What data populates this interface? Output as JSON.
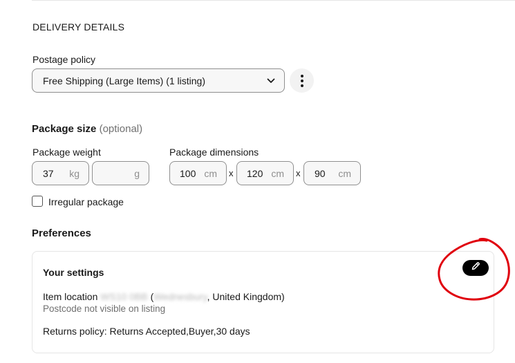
{
  "delivery": {
    "section_title": "DELIVERY DETAILS",
    "postage_label": "Postage policy",
    "postage_value": "Free Shipping (Large Items) (1 listing)"
  },
  "package": {
    "title": "Package size",
    "optional": "(optional)",
    "weight_label": "Package weight",
    "weight_kg": "37",
    "weight_kg_unit": "kg",
    "weight_g": "",
    "weight_g_unit": "g",
    "dimensions_label": "Package dimensions",
    "dim_length": "100",
    "dim_width": "120",
    "dim_height": "90",
    "dim_unit": "cm",
    "times": "x",
    "irregular_label": "Irregular package",
    "irregular_checked": false
  },
  "preferences": {
    "title": "Preferences",
    "card_title": "Your settings",
    "location_prefix": "Item location ",
    "location_postcode": "WS10 0BB",
    "location_paren_open": " (",
    "location_town": "Wednesbury",
    "location_suffix": ", United Kingdom)",
    "postcode_note": "Postcode not visible on listing",
    "returns": "Returns policy: Returns Accepted,Buyer,30 days"
  },
  "icons": {
    "select_chevron": "chevron-down-icon",
    "more": "more-vertical-icon",
    "edit": "pencil-icon"
  },
  "colors": {
    "annotation": "#e0000d",
    "edit_button": "#000000",
    "muted_text": "#707070"
  }
}
